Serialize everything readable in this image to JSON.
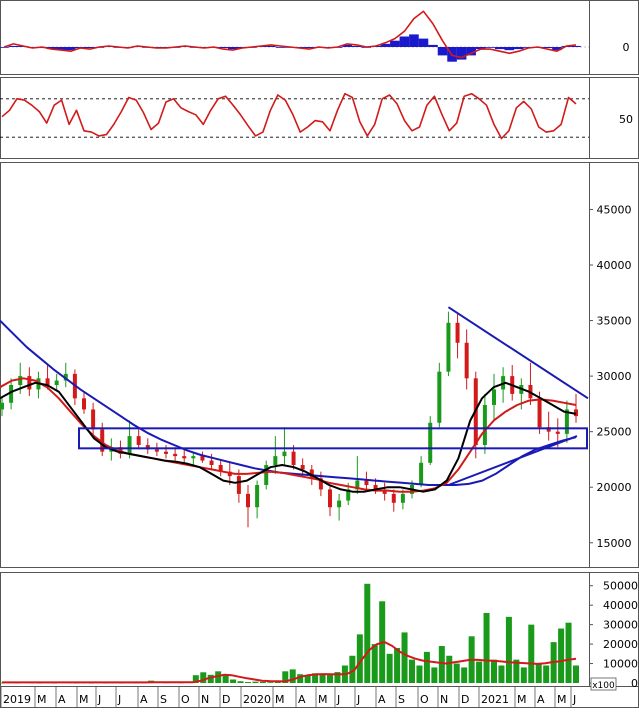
{
  "chart_data": {
    "type": "line",
    "colors": {
      "price_up": "#1a9a1a",
      "price_down": "#d21a1a",
      "ma_black": "#000000",
      "ma_red": "#d21a1a",
      "ma_blue": "#1a1ab4",
      "trendline": "#1a1ab4",
      "macd": "#d21a1a",
      "macd_hist": "#1a1acc",
      "volume_bar": "#1a9a1a",
      "volume_ma": "#d21a1a"
    },
    "x_months": [
      "2019",
      "M",
      "A",
      "M",
      "J",
      "J",
      "A",
      "S",
      "O",
      "N",
      "D",
      "2020",
      "M",
      "A",
      "M",
      "J",
      "J",
      "A",
      "S",
      "O",
      "N",
      "D",
      "2021",
      "M",
      "A",
      "M",
      "J"
    ],
    "macd_panel": {
      "yticks": [
        "0"
      ],
      "macd": [
        0,
        3,
        1,
        -1,
        0,
        -2,
        -3,
        -4,
        -1,
        -2,
        0,
        1,
        0,
        -1,
        1,
        0,
        -1,
        -1,
        0,
        1,
        0,
        -1,
        0,
        -2,
        -3,
        -1,
        0,
        1,
        2,
        1,
        0,
        -1,
        -2,
        0,
        -1,
        0,
        3,
        2,
        0,
        1,
        4,
        8,
        15,
        27,
        34,
        22,
        6,
        -8,
        -10,
        -6,
        -2,
        -2,
        -4,
        -6,
        -4,
        -1,
        0,
        -2,
        -4,
        1,
        2
      ],
      "histogram": [
        0,
        1,
        1,
        -1,
        -1,
        -2,
        -3,
        -3,
        -1,
        -1,
        0,
        1,
        0,
        -1,
        1,
        0,
        -1,
        -1,
        0,
        1,
        0,
        -1,
        0,
        -1,
        -2,
        -1,
        0,
        1,
        1,
        0,
        0,
        -1,
        -1,
        0,
        -1,
        0,
        2,
        1,
        0,
        1,
        3,
        6,
        10,
        12,
        8,
        2,
        -8,
        -14,
        -12,
        -8,
        -2,
        0,
        -2,
        -3,
        -2,
        0,
        0,
        -1,
        -3,
        1,
        1
      ]
    },
    "stoch_panel": {
      "yticks": [
        "50"
      ],
      "upper_level": 80,
      "lower_level": 20,
      "values": [
        52,
        62,
        80,
        78,
        70,
        60,
        42,
        70,
        78,
        40,
        62,
        30,
        28,
        22,
        24,
        40,
        60,
        82,
        78,
        58,
        32,
        42,
        75,
        80,
        66,
        60,
        55,
        40,
        62,
        80,
        84,
        70,
        55,
        38,
        22,
        28,
        62,
        86,
        78,
        56,
        28,
        36,
        46,
        44,
        30,
        62,
        88,
        82,
        44,
        22,
        40,
        80,
        86,
        72,
        46,
        30,
        36,
        70,
        84,
        56,
        30,
        42,
        84,
        88,
        80,
        70,
        40,
        18,
        30,
        66,
        76,
        64,
        36,
        28,
        30,
        40,
        82,
        72
      ]
    },
    "price_panel": {
      "yticks": [
        "15000",
        "20000",
        "25000",
        "30000",
        "35000",
        "40000",
        "45000"
      ],
      "ylim": [
        13000,
        49000
      ],
      "candles": [
        {
          "o": 27000,
          "h": 28200,
          "l": 26400,
          "c": 27600
        },
        {
          "o": 27600,
          "h": 29800,
          "l": 27000,
          "c": 29200
        },
        {
          "o": 29200,
          "h": 31200,
          "l": 28400,
          "c": 30000
        },
        {
          "o": 30000,
          "h": 30800,
          "l": 28200,
          "c": 28800
        },
        {
          "o": 28800,
          "h": 30400,
          "l": 28000,
          "c": 29800
        },
        {
          "o": 29800,
          "h": 31000,
          "l": 28800,
          "c": 29200
        },
        {
          "o": 29200,
          "h": 30200,
          "l": 28600,
          "c": 29600
        },
        {
          "o": 29600,
          "h": 31200,
          "l": 29000,
          "c": 30200
        },
        {
          "o": 30200,
          "h": 30600,
          "l": 27400,
          "c": 28000
        },
        {
          "o": 28000,
          "h": 28600,
          "l": 26600,
          "c": 27000
        },
        {
          "o": 27000,
          "h": 27600,
          "l": 24600,
          "c": 25200
        },
        {
          "o": 25200,
          "h": 25800,
          "l": 22800,
          "c": 23200
        },
        {
          "o": 23200,
          "h": 24400,
          "l": 22400,
          "c": 23600
        },
        {
          "o": 23600,
          "h": 24200,
          "l": 22600,
          "c": 23000
        },
        {
          "o": 23000,
          "h": 26000,
          "l": 22600,
          "c": 24600
        },
        {
          "o": 24600,
          "h": 25400,
          "l": 23400,
          "c": 23800
        },
        {
          "o": 23800,
          "h": 24400,
          "l": 23000,
          "c": 23400
        },
        {
          "o": 23400,
          "h": 24000,
          "l": 22800,
          "c": 23200
        },
        {
          "o": 23200,
          "h": 23800,
          "l": 22600,
          "c": 23000
        },
        {
          "o": 23000,
          "h": 23600,
          "l": 22400,
          "c": 22800
        },
        {
          "o": 22800,
          "h": 23400,
          "l": 22200,
          "c": 22600
        },
        {
          "o": 22600,
          "h": 23200,
          "l": 22000,
          "c": 22800
        },
        {
          "o": 22800,
          "h": 23200,
          "l": 22200,
          "c": 22400
        },
        {
          "o": 22400,
          "h": 23000,
          "l": 21600,
          "c": 22000
        },
        {
          "o": 22000,
          "h": 22400,
          "l": 21000,
          "c": 21400
        },
        {
          "o": 21400,
          "h": 22200,
          "l": 20200,
          "c": 21000
        },
        {
          "o": 21000,
          "h": 21600,
          "l": 18600,
          "c": 19400
        },
        {
          "o": 19400,
          "h": 20200,
          "l": 16400,
          "c": 18200
        },
        {
          "o": 18200,
          "h": 20600,
          "l": 17200,
          "c": 20200
        },
        {
          "o": 20200,
          "h": 22400,
          "l": 19800,
          "c": 22000
        },
        {
          "o": 22000,
          "h": 24600,
          "l": 21200,
          "c": 22800
        },
        {
          "o": 22800,
          "h": 25400,
          "l": 22000,
          "c": 23200
        },
        {
          "o": 23200,
          "h": 23800,
          "l": 21600,
          "c": 22000
        },
        {
          "o": 22000,
          "h": 22600,
          "l": 21000,
          "c": 21600
        },
        {
          "o": 21600,
          "h": 22000,
          "l": 20200,
          "c": 20800
        },
        {
          "o": 20800,
          "h": 21400,
          "l": 19200,
          "c": 19800
        },
        {
          "o": 19800,
          "h": 20200,
          "l": 17400,
          "c": 18200
        },
        {
          "o": 18200,
          "h": 19400,
          "l": 17000,
          "c": 18800
        },
        {
          "o": 18800,
          "h": 20400,
          "l": 18400,
          "c": 19800
        },
        {
          "o": 19800,
          "h": 22800,
          "l": 19400,
          "c": 20600
        },
        {
          "o": 20600,
          "h": 21400,
          "l": 19600,
          "c": 20200
        },
        {
          "o": 20200,
          "h": 20800,
          "l": 19400,
          "c": 19800
        },
        {
          "o": 19800,
          "h": 20400,
          "l": 18800,
          "c": 19400
        },
        {
          "o": 19400,
          "h": 19800,
          "l": 17800,
          "c": 18600
        },
        {
          "o": 18600,
          "h": 19800,
          "l": 18000,
          "c": 19400
        },
        {
          "o": 19400,
          "h": 20600,
          "l": 19000,
          "c": 20200
        },
        {
          "o": 20200,
          "h": 22800,
          "l": 20000,
          "c": 22200
        },
        {
          "o": 22200,
          "h": 26400,
          "l": 22000,
          "c": 25800
        },
        {
          "o": 25800,
          "h": 31200,
          "l": 25400,
          "c": 30400
        },
        {
          "o": 30400,
          "h": 35800,
          "l": 30000,
          "c": 34800
        },
        {
          "o": 34800,
          "h": 35600,
          "l": 31600,
          "c": 33000
        },
        {
          "o": 33000,
          "h": 34200,
          "l": 28800,
          "c": 29800
        },
        {
          "o": 29800,
          "h": 30400,
          "l": 22600,
          "c": 23800
        },
        {
          "o": 23800,
          "h": 28400,
          "l": 23000,
          "c": 27400
        },
        {
          "o": 27400,
          "h": 30200,
          "l": 26000,
          "c": 28800
        },
        {
          "o": 28800,
          "h": 30800,
          "l": 27600,
          "c": 30000
        },
        {
          "o": 30000,
          "h": 31000,
          "l": 27800,
          "c": 28400
        },
        {
          "o": 28400,
          "h": 29800,
          "l": 27000,
          "c": 29200
        },
        {
          "o": 29200,
          "h": 31200,
          "l": 27400,
          "c": 28000
        },
        {
          "o": 28000,
          "h": 28600,
          "l": 24800,
          "c": 25400
        },
        {
          "o": 25400,
          "h": 26800,
          "l": 24200,
          "c": 25000
        },
        {
          "o": 25000,
          "h": 26200,
          "l": 23600,
          "c": 24800
        },
        {
          "o": 24800,
          "h": 27800,
          "l": 24000,
          "c": 27000
        },
        {
          "o": 27000,
          "h": 28400,
          "l": 25800,
          "c": 26400
        }
      ],
      "ma_black": [
        28000,
        28600,
        29000,
        29400,
        29200,
        28600,
        27200,
        25800,
        24400,
        23600,
        23200,
        23000,
        22800,
        22600,
        22400,
        22300,
        22100,
        21800,
        21200,
        20600,
        20400,
        20600,
        21200,
        21800,
        22000,
        21800,
        21400,
        20800,
        20200,
        19800,
        19600,
        19600,
        19800,
        20000,
        20000,
        19800,
        19600,
        19800,
        20600,
        22600,
        26000,
        28000,
        29000,
        29400,
        29000,
        28600,
        28000,
        27400,
        26800,
        26600
      ],
      "ma_red": [
        29000,
        29600,
        29800,
        29600,
        29000,
        28000,
        26800,
        25600,
        24600,
        23800,
        23300,
        23000,
        22800,
        22600,
        22400,
        22200,
        22000,
        21800,
        21600,
        21400,
        21200,
        21200,
        21300,
        21400,
        21300,
        21100,
        20900,
        20700,
        20400,
        20200,
        20000,
        19800,
        19700,
        19700,
        19600,
        19600,
        19700,
        19900,
        20400,
        21600,
        23200,
        24800,
        26000,
        26800,
        27400,
        27800,
        27900,
        27800,
        27600,
        27400
      ],
      "ma_blue": [
        35000,
        33800,
        32600,
        31600,
        30600,
        29700,
        28800,
        28000,
        27200,
        26400,
        25600,
        24900,
        24300,
        23800,
        23300,
        22900,
        22600,
        22300,
        22000,
        21700,
        21500,
        21300,
        21200,
        21100,
        21000,
        20900,
        20800,
        20700,
        20600,
        20500,
        20400,
        20300,
        20200,
        20200,
        20200,
        20300,
        20600,
        21200,
        22000,
        22800,
        23400,
        23800,
        24200,
        24500
      ],
      "trendline_top": [
        {
          "x": 49,
          "y": 36200
        },
        {
          "x": 63,
          "y": 28000
        }
      ],
      "trendline_bottom": [
        {
          "x": 49,
          "y": 20200
        },
        {
          "x": 63,
          "y": 24600
        }
      ],
      "box": {
        "y_low": 23500,
        "y_high": 25300
      }
    },
    "volume_panel": {
      "yticks": [
        "0",
        "10000",
        "20000",
        "30000",
        "40000",
        "50000"
      ],
      "unit_label": "x100",
      "ylim": [
        0,
        55000
      ],
      "bars": [
        200,
        300,
        200,
        400,
        300,
        200,
        300,
        200,
        400,
        300,
        200,
        300,
        200,
        300,
        200,
        300,
        200,
        300,
        200,
        300,
        1200,
        500,
        300,
        400,
        300,
        500,
        4000,
        5500,
        4200,
        6000,
        3800,
        1800,
        900,
        500,
        700,
        600,
        400,
        500,
        6000,
        7000,
        4500,
        3600,
        5000,
        4800,
        4200,
        5600,
        9000,
        14000,
        25000,
        51000,
        20000,
        42000,
        15000,
        18000,
        26000,
        12000,
        9000,
        16000,
        8000,
        19000,
        14000,
        10000,
        8000,
        24000,
        11000,
        36000,
        12000,
        9000,
        34000,
        12000,
        8000,
        30000,
        10000,
        9000,
        21000,
        28000,
        31000,
        9000
      ],
      "ma": [
        300,
        300,
        300,
        300,
        300,
        300,
        300,
        300,
        300,
        300,
        300,
        300,
        300,
        300,
        300,
        300,
        300,
        300,
        300,
        300,
        400,
        400,
        400,
        400,
        400,
        400,
        1200,
        2500,
        3400,
        4200,
        4000,
        3200,
        2400,
        1800,
        1200,
        1000,
        900,
        800,
        1800,
        3200,
        4000,
        4400,
        4600,
        4500,
        4400,
        4600,
        6400,
        12000,
        17000,
        20000,
        21000,
        19000,
        16000,
        14000,
        12500,
        11500,
        11000,
        10500,
        10000,
        10600,
        11200,
        11800,
        12000,
        11600,
        11400,
        11200,
        10800,
        10500,
        10300,
        10000,
        9800,
        10200,
        10800,
        11200,
        12000,
        12500
      ]
    }
  }
}
